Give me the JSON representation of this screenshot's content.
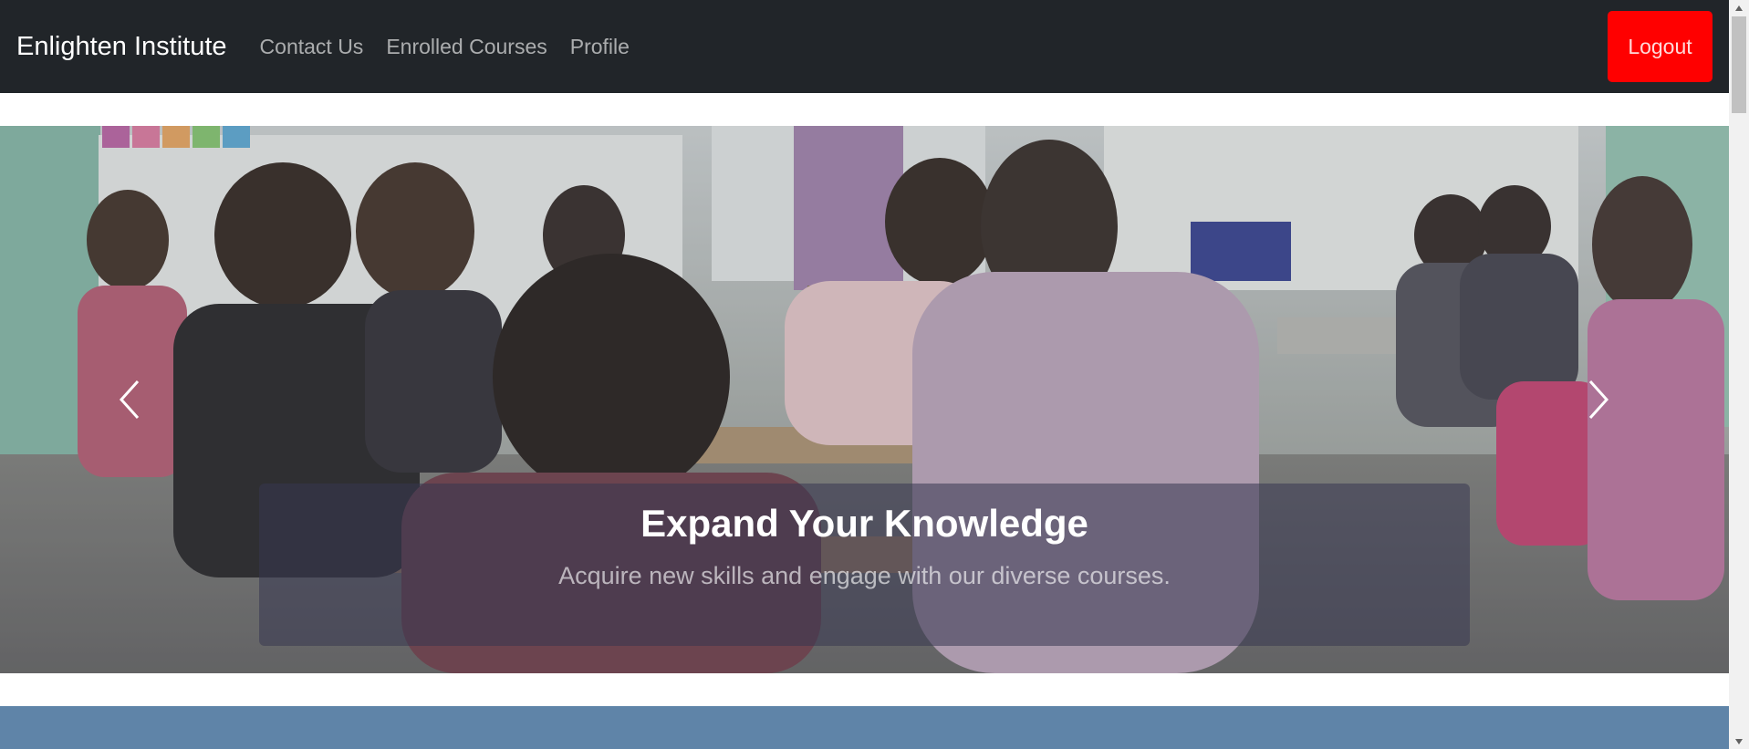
{
  "navbar": {
    "brand": "Enlighten Institute",
    "links": [
      "Contact Us",
      "Enrolled Courses",
      "Profile"
    ],
    "logout_label": "Logout"
  },
  "carousel": {
    "caption_title": "Expand Your Knowledge",
    "caption_text": "Acquire new skills and engage with our diverse courses.",
    "prev_icon": "chevron-left-icon",
    "next_icon": "chevron-right-icon"
  },
  "colors": {
    "navbar_bg": "#212529",
    "logout_bg": "#ff0000",
    "section_bg": "#5f84a8"
  }
}
